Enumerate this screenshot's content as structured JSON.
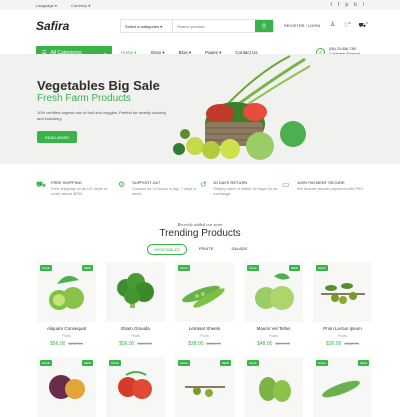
{
  "topbar": {
    "language": "Language",
    "currency": "Currency",
    "social": [
      "t",
      "f",
      "p",
      "b",
      "i"
    ]
  },
  "header": {
    "logo": "Safira",
    "category_select": "Select a categories",
    "search_placeholder": "Search product...",
    "account": "REGISTER / LOGIN",
    "wishlist_count": "0",
    "cart_count": "0"
  },
  "nav": {
    "all_categories": "All Categories",
    "items": [
      "Home",
      "Shop",
      "Blog",
      "Pages",
      "Contact Us"
    ],
    "phone": "(08) 23 456 789",
    "support_label": "Customer Support"
  },
  "hero": {
    "title": "Vegetables Big Sale",
    "subtitle": "Fresh Farm Products",
    "text": "10% certified-organic mix of fruit and veggies. Perfect for weekly cooking and snacking!",
    "button": "READ MORE"
  },
  "features": [
    {
      "title": "FREE SHIPPING",
      "text": "Free shipping on all US order or order above $200"
    },
    {
      "title": "SUPPORT 24/7",
      "text": "Contact us 24 hours a day, 7 days a week"
    },
    {
      "title": "30 DAYS RETURN",
      "text": "Simply return it within 30 days for an exchange"
    },
    {
      "title": "100% PAYMENT SECURE",
      "text": "We ensure secure payment with PEV"
    }
  ],
  "trending": {
    "subtitle": "Recently added our store",
    "title": "Trending Products",
    "tabs": [
      "VEGETABLES",
      "FRUITE",
      "SALADS"
    ]
  },
  "products": [
    {
      "name": "Aliquam Consequat",
      "cat": "Fruits",
      "price": "$56.00",
      "old": "$262.00",
      "badges": [
        "SALE",
        "NEW"
      ]
    },
    {
      "name": "Etiam Gravida",
      "cat": "Fruits",
      "price": "$56.00",
      "old": "$422.00",
      "badges": []
    },
    {
      "name": "Letraset Sheets",
      "cat": "Fruits",
      "price": "$38.00",
      "old": "$282.00",
      "badges": [
        "SALE"
      ]
    },
    {
      "name": "Mauris Vel Tellus",
      "cat": "Fruits",
      "price": "$48.00",
      "old": "$297.00",
      "badges": [
        "SALE",
        "NEW"
      ]
    },
    {
      "name": "Proin Lectus Ipsum",
      "cat": "Fruits",
      "price": "$36.00",
      "old": "$362.00",
      "badges": [
        "SALE"
      ]
    }
  ],
  "products_row2": [
    {
      "badges": [
        "SALE",
        "NEW"
      ]
    },
    {
      "badges": [
        "SALE"
      ]
    },
    {
      "badges": [
        "SALE",
        "NEW"
      ]
    },
    {
      "badges": [
        "SALE"
      ]
    },
    {
      "badges": [
        "SALE",
        "NEW"
      ]
    }
  ]
}
